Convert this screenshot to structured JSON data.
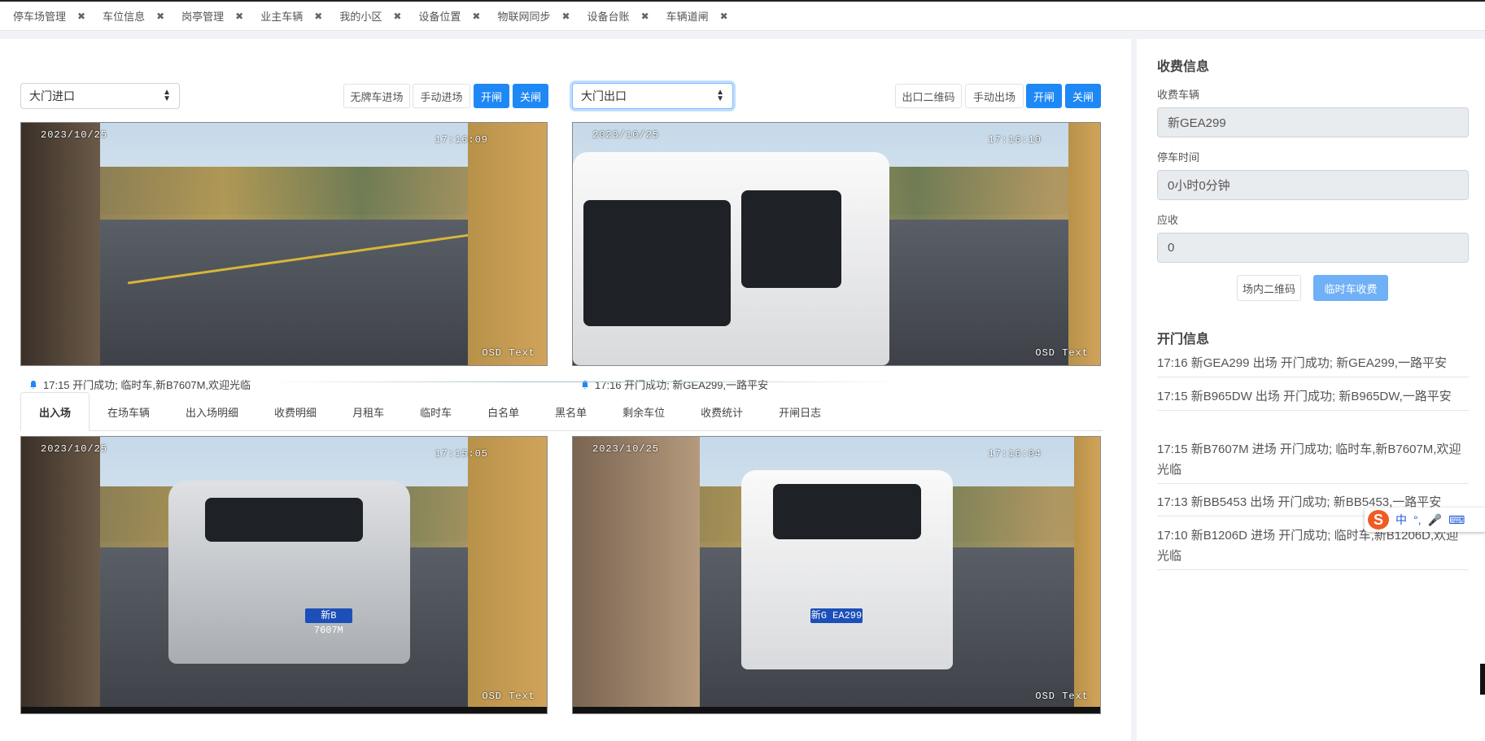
{
  "tabs": [
    {
      "label": "停车场管理"
    },
    {
      "label": "车位信息"
    },
    {
      "label": "岗亭管理"
    },
    {
      "label": "业主车辆"
    },
    {
      "label": "我的小区"
    },
    {
      "label": "设备位置"
    },
    {
      "label": "物联网同步"
    },
    {
      "label": "设备台账"
    },
    {
      "label": "车辆道闸"
    }
  ],
  "tab_close_glyph": "✖",
  "entrance": {
    "select_value": "大门进口",
    "btn_no_plate": "无牌车进场",
    "btn_manual": "手动进场",
    "btn_open": "开闸",
    "btn_close": "关闸",
    "cam_top": {
      "date": "2023/10/25",
      "time": "17:16:09",
      "osd": "OSD Text"
    },
    "message": "17:15 开门成功; 临时车,新B7607M,欢迎光临",
    "cam_bottom": {
      "date": "2023/10/25",
      "time": "17:15:05",
      "osd": "OSD Text",
      "plate": "新B 7607M"
    }
  },
  "exit": {
    "select_value": "大门出口",
    "btn_qr": "出口二维码",
    "btn_manual": "手动出场",
    "btn_open": "开闸",
    "btn_close": "关闸",
    "cam_top": {
      "date": "2023/10/25",
      "time": "17:16:10",
      "osd": "OSD Text"
    },
    "message": "17:16 开门成功; 新GEA299,一路平安",
    "cam_bottom": {
      "date": "2023/10/25",
      "time": "17:16:04",
      "osd": "OSD Text",
      "plate": "新G EA299"
    }
  },
  "subtabs": [
    "出入场",
    "在场车辆",
    "出入场明细",
    "收费明细",
    "月租车",
    "临时车",
    "白名单",
    "黑名单",
    "剩余车位",
    "收费统计",
    "开闸日志"
  ],
  "fee": {
    "title": "收费信息",
    "vehicle_label": "收费车辆",
    "vehicle_value": "新GEA299",
    "time_label": "停车时间",
    "time_value": "0小时0分钟",
    "due_label": "应收",
    "due_value": "0",
    "btn_qr": "场内二维码",
    "btn_charge": "临时车收费"
  },
  "gate_log": {
    "title": "开门信息",
    "items": [
      "17:16 新GEA299 出场 开门成功; 新GEA299,一路平安",
      "17:15 新B965DW 出场 开门成功; 新B965DW,一路平安",
      "17:15 新B7607M 进场 开门成功; 临时车,新B7607M,欢迎光临",
      "17:13 新BB5453 出场 开门成功; 新BB5453,一路平安",
      "17:10 新B1206D 进场 开门成功; 临时车,新B1206D,欢迎光临"
    ]
  },
  "ime": {
    "logo": "S",
    "mode": "中",
    "punct": "°,",
    "mic": "🎤",
    "kbd": "⌨"
  },
  "colors": {
    "primary": "#1e88f5",
    "primary_soft": "#6fb0f7",
    "field_bg": "#e9ecef"
  }
}
